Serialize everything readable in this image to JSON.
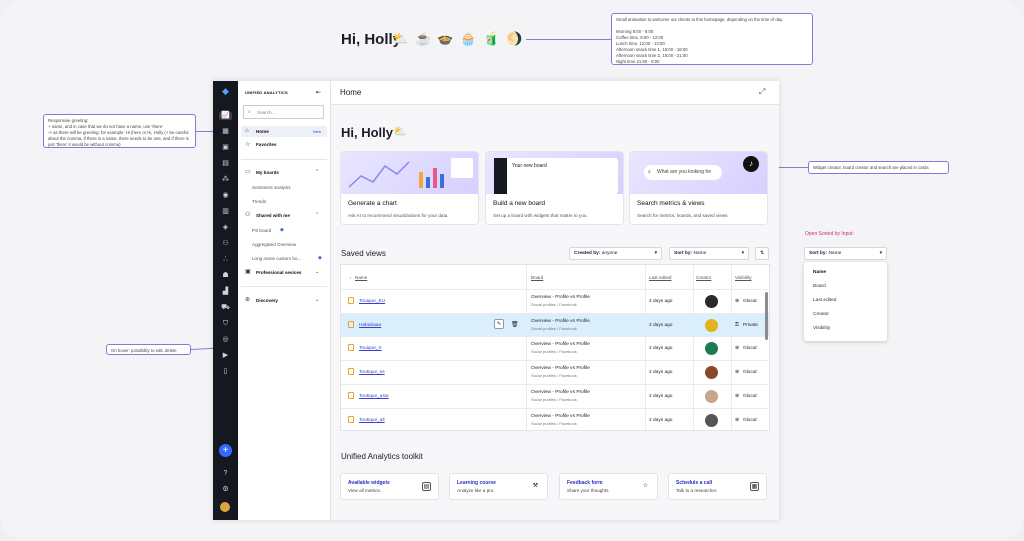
{
  "greeting": {
    "text": "Hi, Holly",
    "emojis": [
      "⛅",
      "☕",
      "🍲",
      "🧁",
      "🧃",
      "🌖"
    ]
  },
  "notes": {
    "animation": "Small animation to welcome our clients to this homepage, depending on the time of day.\n\nMorning 8:00 - 9:00\nCoffee time, 9:00 - 12:00\nLunch time, 12:00 - 13:00\nAfternoon snack time 1, 15:00 - 18:00\nAfternoon snack time 2, 18:00 - 21:00\nNight time 21:00 - 8:00",
    "greeting": "Responsive greeting:\n+ name, and in case that we do not have a name, use 'there'\n-> as there will be greeting: for example: Hi (here or Hi, Holly (+ be careful about the comma, if there is a name, there needs to be one, and if there is just 'there' it would be without comma)",
    "cards": "Widget creator, board creator and search are placed in cards",
    "hover": "On hover: possibility to edit, delete",
    "sorted": "Open Sorted by Input:"
  },
  "sidebar": {
    "title": "UNIFIED ANALYTICS",
    "search_placeholder": "Search...",
    "home": "Home",
    "new_badge": "New",
    "favorites": "Favorites",
    "my_boards": "My boards",
    "my_items": [
      "Sentiment analysis",
      "Trends"
    ],
    "shared": "Shared with me",
    "shared_items": [
      "PS board",
      "Aggregated Overview",
      "Long name custom bo..."
    ],
    "professional": "Professional sevices",
    "discovery": "Discovery"
  },
  "header": {
    "title": "Home"
  },
  "main": {
    "greeting": "Hi, Holly",
    "greeting_emoji": "⛅"
  },
  "cards": [
    {
      "title": "Generate a chart",
      "desc": "Ask AI to recommend visualizations for your data."
    },
    {
      "title": "Build a new board",
      "desc": "Set up a board with widgets that matter to you.",
      "inner": "Your new board"
    },
    {
      "title": "Search metrics & views",
      "desc": "Search for metrics, boards, and saved views.",
      "inner": "What are you looking for"
    }
  ],
  "saved": {
    "title": "Saved views",
    "created_label": "Created by:",
    "created_value": "anyone",
    "sort_label": "Sort by:",
    "sort_value": "Name",
    "columns": [
      "Name",
      "Board",
      "Last edited",
      "Creator",
      "Visibility"
    ],
    "rows": [
      {
        "name": "Touique_EU",
        "board": "Overview - Profile vs Profile",
        "sub": "Social profiles / Facebook",
        "edited": "2 days ago",
        "vis": "Glocal",
        "av": "#2a2a2a"
      },
      {
        "name": "Hababaaa",
        "board": "Overview - Profile vs Profile",
        "sub": "Social profiles / Facebook",
        "edited": "2 days ago",
        "vis": "Private",
        "av": "#e3b21d"
      },
      {
        "name": "Touique_rr",
        "board": "Overview - Profile vs Profile",
        "sub": "Social profiles / Facebook",
        "edited": "2 days ago",
        "vis": "Glocal",
        "av": "#1d7a52"
      },
      {
        "name": "Toutique_ss",
        "board": "Overview - Profile vs Profile",
        "sub": "Social profiles / Facebook",
        "edited": "2 days ago",
        "vis": "Glocal",
        "av": "#8a4a2a"
      },
      {
        "name": "Toutique_asia",
        "board": "Overview - Profile vs Profile",
        "sub": "Social profiles / Facebook",
        "edited": "2 days ago",
        "vis": "Glocal",
        "av": "#c9a48a"
      },
      {
        "name": "Toutique_all",
        "board": "Overview - Profile vs Profile",
        "sub": "Social profiles / Facebook",
        "edited": "2 days ago",
        "vis": "Glocal",
        "av": "#555555"
      }
    ]
  },
  "toolkit": {
    "title": "Unified Analytics toolkit",
    "items": [
      {
        "title": "Available widgets",
        "desc": "View all metrics."
      },
      {
        "title": "Learning course",
        "desc": "Analyze like a pro."
      },
      {
        "title": "Feedback form",
        "desc": "Share your thoughts."
      },
      {
        "title": "Schedule a call",
        "desc": "Talk to a researcher."
      }
    ]
  },
  "dropdown": {
    "label": "Sort by:",
    "value": "Name",
    "options": [
      "Name",
      "Board",
      "Last edited",
      "Creator",
      "Visibility"
    ]
  },
  "colors": {
    "accent": "#3b3ec9",
    "rail": "#15181f",
    "highlight": "#dbeefc",
    "note_border": "#8a78d8"
  }
}
